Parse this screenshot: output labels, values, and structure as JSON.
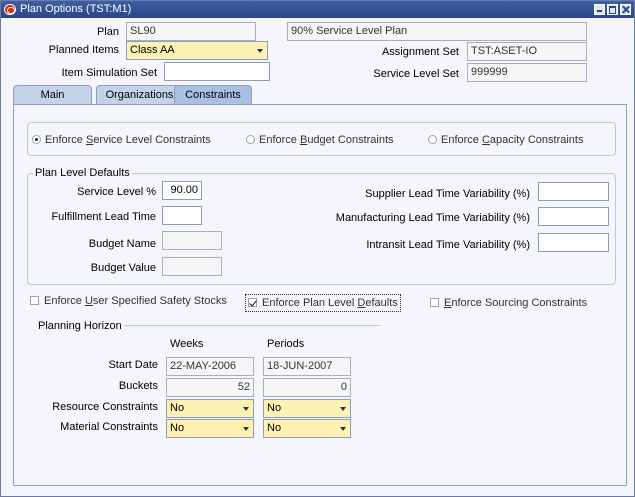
{
  "window": {
    "title": "Plan Options (TST:M1)"
  },
  "header": {
    "plan_label": "Plan",
    "plan_value": "SL90",
    "plan_description": "90% Service Level Plan",
    "planned_items_label": "Planned Items",
    "planned_items_value": "Class AA",
    "item_simulation_set_label": "Item Simulation Set",
    "item_simulation_set_value": "",
    "assignment_set_label": "Assignment Set",
    "assignment_set_value": "TST:ASET-IO",
    "service_level_set_label": "Service Level Set",
    "service_level_set_value": "999999"
  },
  "tabs": [
    {
      "label": "Main",
      "active": false
    },
    {
      "label": "Organizations",
      "active": false
    },
    {
      "label": "Constraints",
      "active": true
    }
  ],
  "enforce_radios": {
    "service_pre": "Enforce ",
    "service_key": "S",
    "service_post": "ervice Level Constraints",
    "budget_pre": "Enforce ",
    "budget_key": "B",
    "budget_post": "udget Constraints",
    "capacity_pre": "Enforce ",
    "capacity_key": "C",
    "capacity_post": "apacity Constraints",
    "selected": "service"
  },
  "plan_level_defaults": {
    "legend": "Plan Level Defaults",
    "service_level_label": "Service Level %",
    "service_level_value": "90.00",
    "fulfillment_lead_time_label": "Fulfillment Lead Time",
    "fulfillment_lead_time_value": "",
    "budget_name_label": "Budget Name",
    "budget_name_value": "",
    "budget_value_label": "Budget Value",
    "budget_value_value": "",
    "supplier_ltv_label": "Supplier  Lead Time Variability (%)",
    "supplier_ltv_value": "",
    "manufacturing_ltv_label": "Manufacturing Lead Time Variability (%)",
    "manufacturing_ltv_value": "",
    "intransit_ltv_label": "Intransit  Lead Time Variability (%)",
    "intransit_ltv_value": ""
  },
  "checkboxes": {
    "safety_pre": "Enforce ",
    "safety_key": "U",
    "safety_post": "ser Specified Safety Stocks",
    "safety_checked": false,
    "plan_defaults_pre": "Enforce Plan Level ",
    "plan_defaults_key": "D",
    "plan_defaults_post": "efaults",
    "plan_defaults_checked": true,
    "sourcing_pre": "",
    "sourcing_key": "E",
    "sourcing_post": "nforce Sourcing Constraints",
    "sourcing_checked": false
  },
  "planning_horizon": {
    "legend": "Planning Horizon",
    "weeks_header": "Weeks",
    "periods_header": "Periods",
    "start_date_label": "Start Date",
    "weeks_start_date": "22-MAY-2006",
    "periods_start_date": "18-JUN-2007",
    "buckets_label": "Buckets",
    "weeks_buckets": "52",
    "periods_buckets": "0",
    "resource_constraints_label": "Resource Constraints",
    "weeks_resource": "No",
    "periods_resource": "No",
    "material_constraints_label": "Material Constraints",
    "weeks_material": "No",
    "periods_material": "No"
  }
}
